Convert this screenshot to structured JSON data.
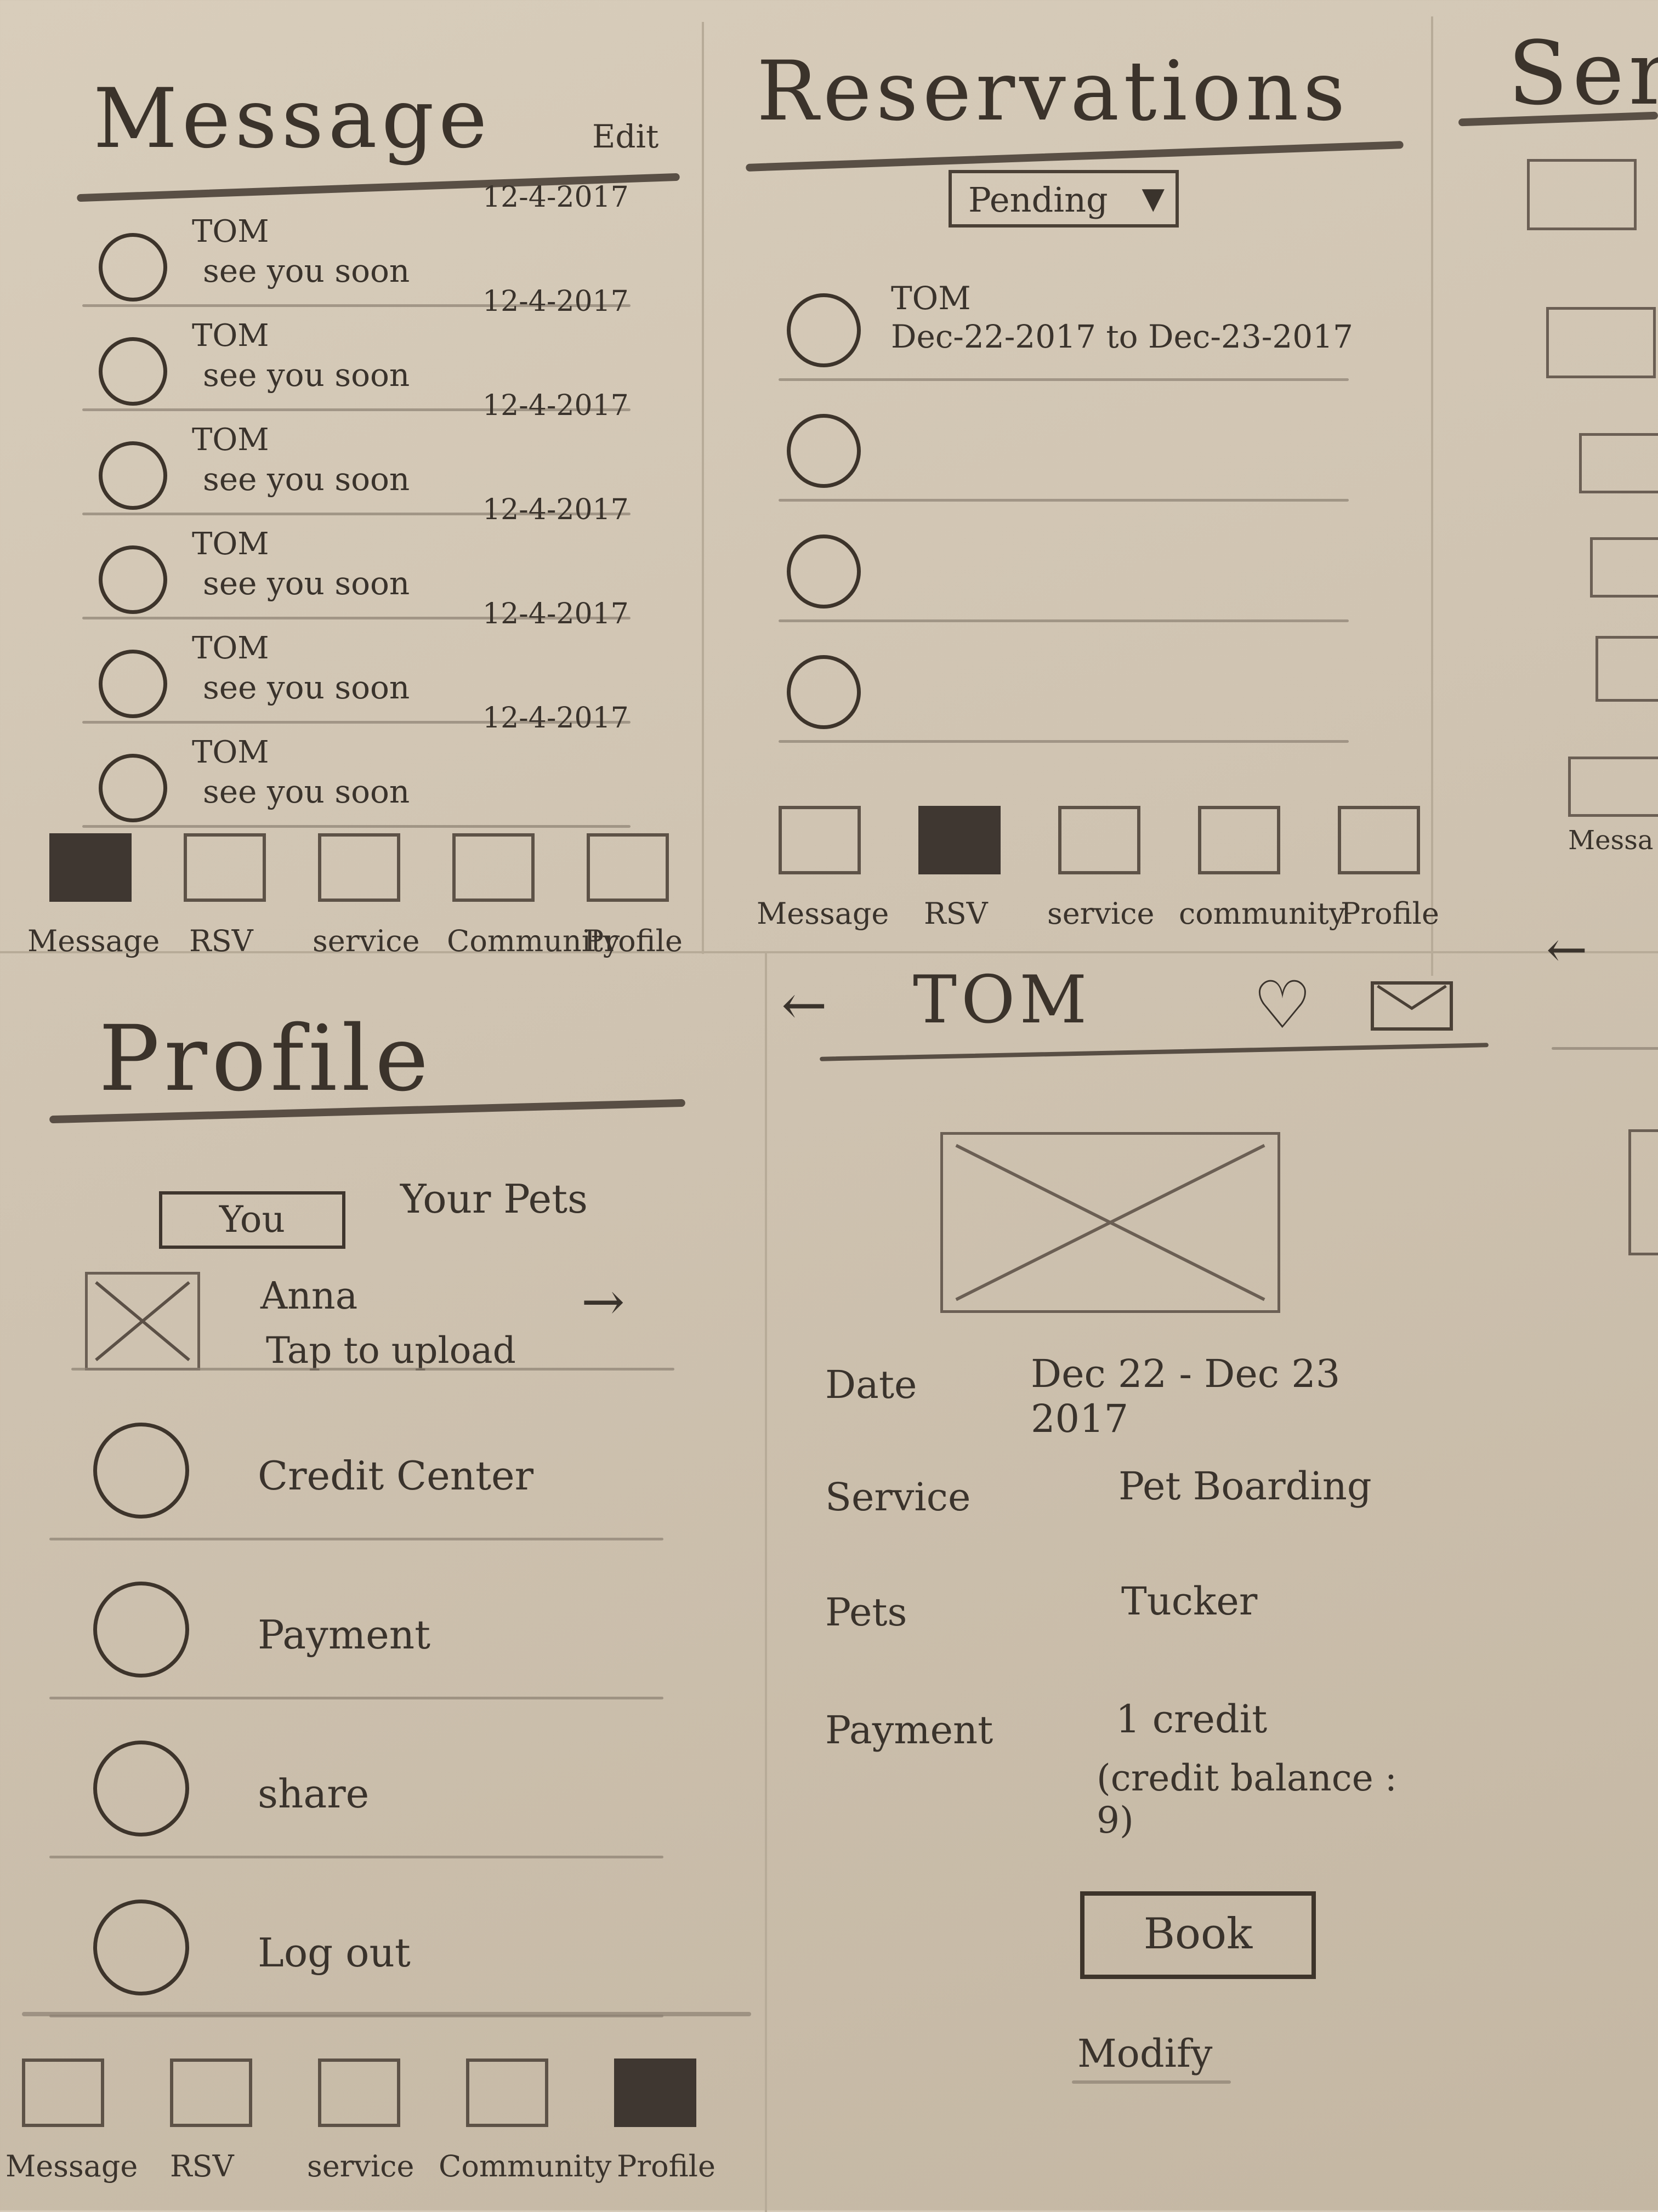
{
  "message_screen": {
    "title": "Message",
    "edit_label": "Edit",
    "items": [
      {
        "name": "TOM",
        "preview": "see you soon",
        "date": "12-4-2017"
      },
      {
        "name": "TOM",
        "preview": "see you soon",
        "date": "12-4-2017"
      },
      {
        "name": "TOM",
        "preview": "see you soon",
        "date": "12-4-2017"
      },
      {
        "name": "TOM",
        "preview": "see you soon",
        "date": "12-4-2017"
      },
      {
        "name": "TOM",
        "preview": "see you soon",
        "date": "12-4-2017"
      },
      {
        "name": "TOM",
        "preview": "see you soon",
        "date": "12-4-2017"
      }
    ],
    "nav": [
      {
        "label": "Message",
        "active": true
      },
      {
        "label": "RSV",
        "active": false
      },
      {
        "label": "service",
        "active": false
      },
      {
        "label": "Community",
        "active": false
      },
      {
        "label": "Profile",
        "active": false
      }
    ]
  },
  "reservations_screen": {
    "title": "Reservations",
    "filter_value": "Pending",
    "items": [
      {
        "name": "TOM",
        "dates": "Dec-22-2017 to Dec-23-2017"
      },
      {
        "name": "",
        "dates": ""
      },
      {
        "name": "",
        "dates": ""
      },
      {
        "name": "",
        "dates": ""
      }
    ],
    "nav": [
      {
        "label": "Message",
        "active": false
      },
      {
        "label": "RSV",
        "active": true
      },
      {
        "label": "service",
        "active": false
      },
      {
        "label": "community",
        "active": false
      },
      {
        "label": "Profile",
        "active": false
      }
    ]
  },
  "service_screen": {
    "title_fragment": "Ser",
    "nav_fragment": "Messa"
  },
  "profile_screen": {
    "title": "Profile",
    "tabs": [
      {
        "label": "You",
        "active": true
      },
      {
        "label": "Your Pets",
        "active": false
      }
    ],
    "user": {
      "name": "Anna",
      "upload_hint": "Tap to upload"
    },
    "menu": [
      {
        "label": "Credit Center"
      },
      {
        "label": "Payment"
      },
      {
        "label": "share"
      },
      {
        "label": "Log out"
      }
    ],
    "nav": [
      {
        "label": "Message",
        "active": false
      },
      {
        "label": "RSV",
        "active": false
      },
      {
        "label": "service",
        "active": false
      },
      {
        "label": "Community",
        "active": false
      },
      {
        "label": "Profile",
        "active": true
      }
    ]
  },
  "detail_screen": {
    "title": "TOM",
    "back_icon": "back-arrow-icon",
    "favorite_icon": "heart-icon",
    "message_icon": "envelope-icon",
    "fields": [
      {
        "label": "Date",
        "value": "Dec 22 - Dec 23 2017"
      },
      {
        "label": "Service",
        "value": "Pet Boarding"
      },
      {
        "label": "Pets",
        "value": "Tucker"
      },
      {
        "label": "Payment",
        "value": "1 credit"
      }
    ],
    "credit_balance": "(credit balance : 9)",
    "book_label": "Book",
    "modify_label": "Modify"
  }
}
